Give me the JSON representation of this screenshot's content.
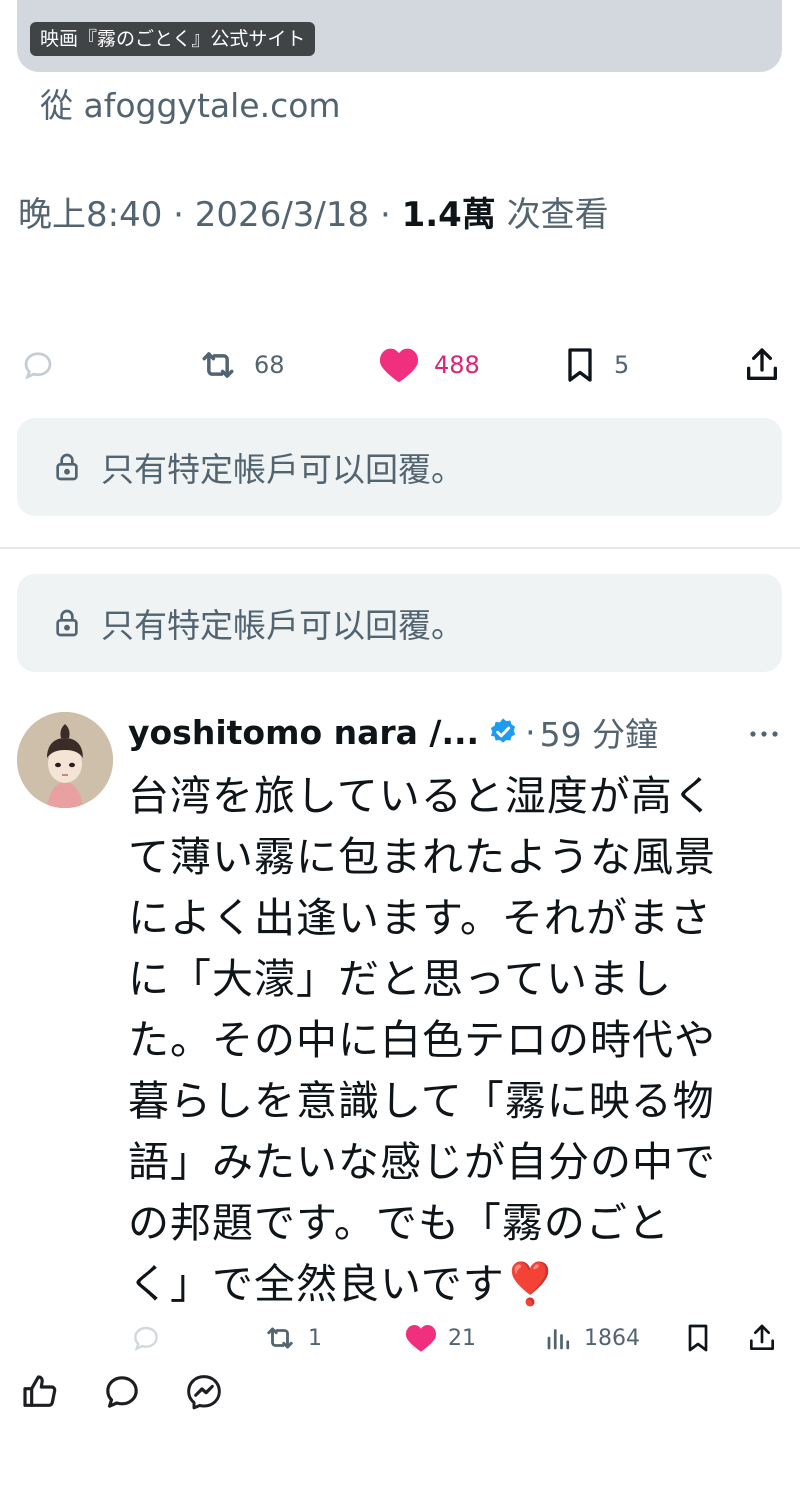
{
  "link_card": {
    "tag": "映画『霧のごとく』公式サイト",
    "source": "從 afoggytale.com"
  },
  "post_meta": {
    "time": "晚上8:40",
    "sep1": "·",
    "date": "2026/3/18",
    "sep2": "·",
    "views": "1.4萬",
    "views_suffix": "次查看"
  },
  "post_actions": {
    "reply_icon": "reply-icon",
    "retweets": "68",
    "likes": "488",
    "bookmarks": "5",
    "share_icon": "share-icon",
    "like_color": "#f91880"
  },
  "restricted_replies": [
    {
      "text": "只有特定帳戶可以回覆。",
      "icon": "lock-icon"
    },
    {
      "text": "只有特定帳戶可以回覆。",
      "icon": "lock-icon"
    }
  ],
  "reply": {
    "author": "yoshitomo nara /...",
    "verified_icon": "verified-badge-icon",
    "dot": "·",
    "time": "59 分鐘",
    "text": "台湾を旅していると湿度が高く\nて薄い霧に包まれたような風景\nによく出逢います。それがまさ\nに「大濛」だと思っていまし\nた。その中に白色テロの時代や\n暮らしを意識して「霧に映る物\n語」みたいな感じが自分の中で\nの邦題です。でも「霧のごと\nく」で全然良いです",
    "emoji": "❣️",
    "retweets": "1",
    "likes": "21",
    "views": "1864",
    "accent": "#1d9bf0"
  },
  "bottom_bar": {
    "icons": [
      "thumbs-up-icon",
      "comment-icon",
      "messenger-icon"
    ]
  }
}
